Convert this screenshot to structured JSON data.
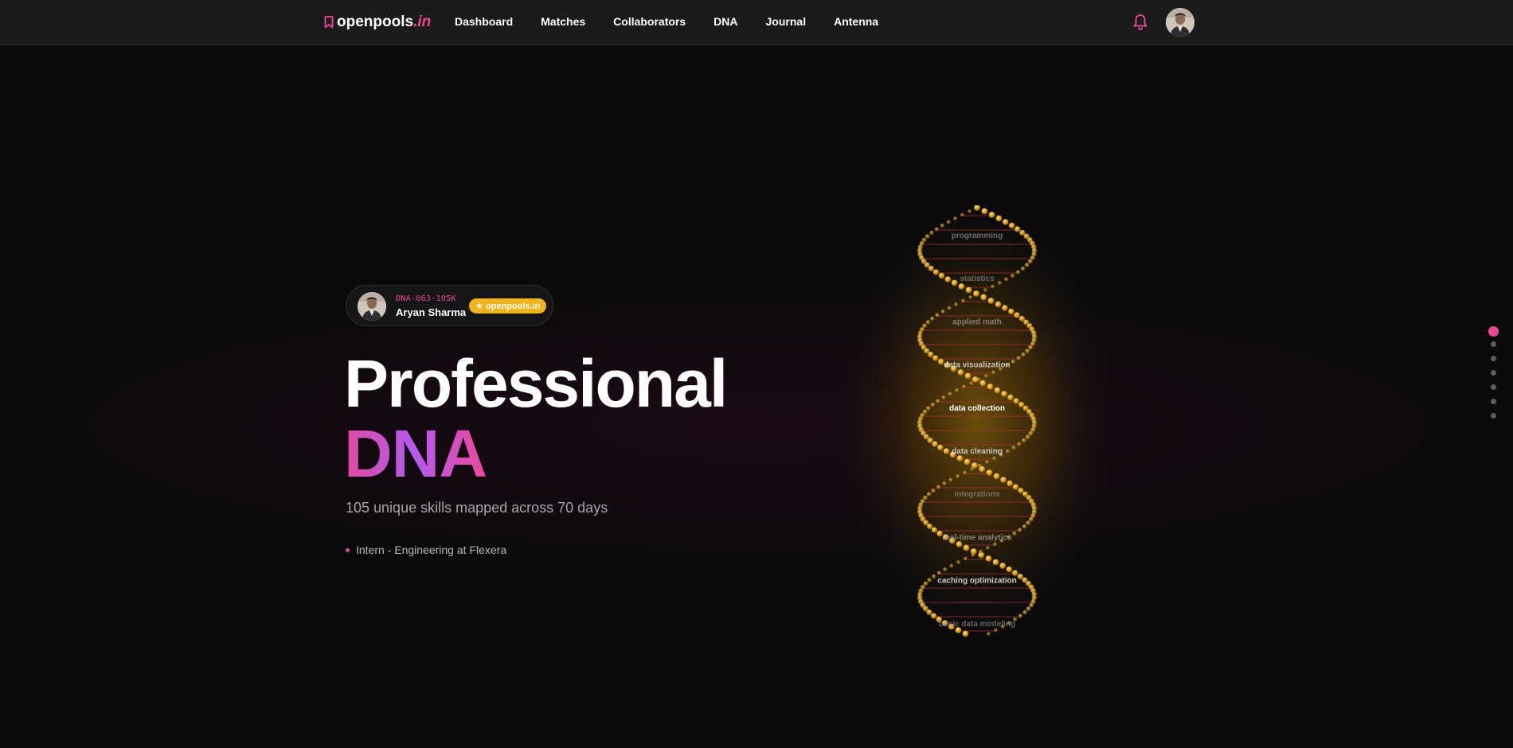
{
  "brand": {
    "name": "openpools",
    "tld": ".in",
    "icon": "bookmark-icon"
  },
  "nav": [
    {
      "label": "Dashboard"
    },
    {
      "label": "Matches"
    },
    {
      "label": "Collaborators"
    },
    {
      "label": "DNA"
    },
    {
      "label": "Journal"
    },
    {
      "label": "Antenna"
    }
  ],
  "header_icons": {
    "notifications": "bell-icon",
    "profile": "avatar"
  },
  "profile": {
    "code": "DNA-063-105K",
    "name": "Aryan Sharma",
    "badge": "openpools.in",
    "badge_icon": "star-icon"
  },
  "hero": {
    "title_line1": "Professional",
    "title_line2": "DNA",
    "subtitle": "105 unique skills mapped across 70 days",
    "role": "Intern - Engineering at Flexera"
  },
  "skills": [
    {
      "label": "programming",
      "brightness": 0.35
    },
    {
      "label": "statistics",
      "brightness": 0.3
    },
    {
      "label": "applied math",
      "brightness": 0.4
    },
    {
      "label": "data visualization",
      "brightness": 0.75
    },
    {
      "label": "data collection",
      "brightness": 1.0
    },
    {
      "label": "data cleaning",
      "brightness": 0.75
    },
    {
      "label": "integrations",
      "brightness": 0.3
    },
    {
      "label": "real-time analytics",
      "brightness": 0.45
    },
    {
      "label": "caching optimization",
      "brightness": 0.8
    },
    {
      "label": "basic data modeling",
      "brightness": 0.3
    }
  ],
  "section_nav": {
    "count": 7,
    "active_index": 0
  },
  "colors": {
    "accent": "#ec4899",
    "gold": "#f2b31b",
    "purple": "#b35af0"
  }
}
